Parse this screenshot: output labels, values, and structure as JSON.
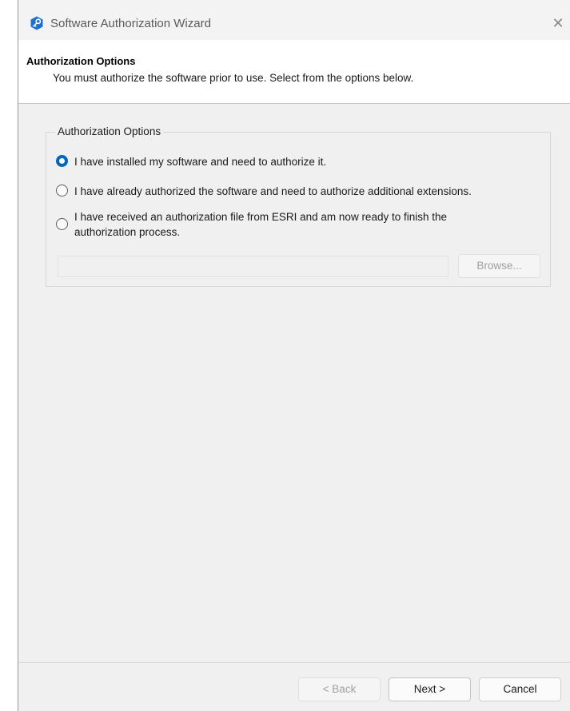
{
  "window": {
    "title": "Software Authorization Wizard",
    "close_glyph": "✕"
  },
  "header": {
    "title": "Authorization Options",
    "subtitle": "You must authorize the software prior to use. Select from the options below."
  },
  "group": {
    "legend": "Authorization Options",
    "options": [
      {
        "label": "I have installed my software and need to authorize it.",
        "selected": true
      },
      {
        "label": "I have already authorized the software and need to authorize additional extensions.",
        "selected": false
      },
      {
        "label_line1": "I have received an authorization file from ESRI and am now ready to finish the",
        "label_line2": "authorization process.",
        "selected": false
      }
    ],
    "file_path_value": "",
    "browse_label": "Browse..."
  },
  "footer": {
    "back_label": "< Back",
    "next_label": "Next >",
    "cancel_label": "Cancel"
  },
  "colors": {
    "accent": "#0067c0",
    "window_bg": "#f0f0f0",
    "header_bg": "#ffffff"
  }
}
